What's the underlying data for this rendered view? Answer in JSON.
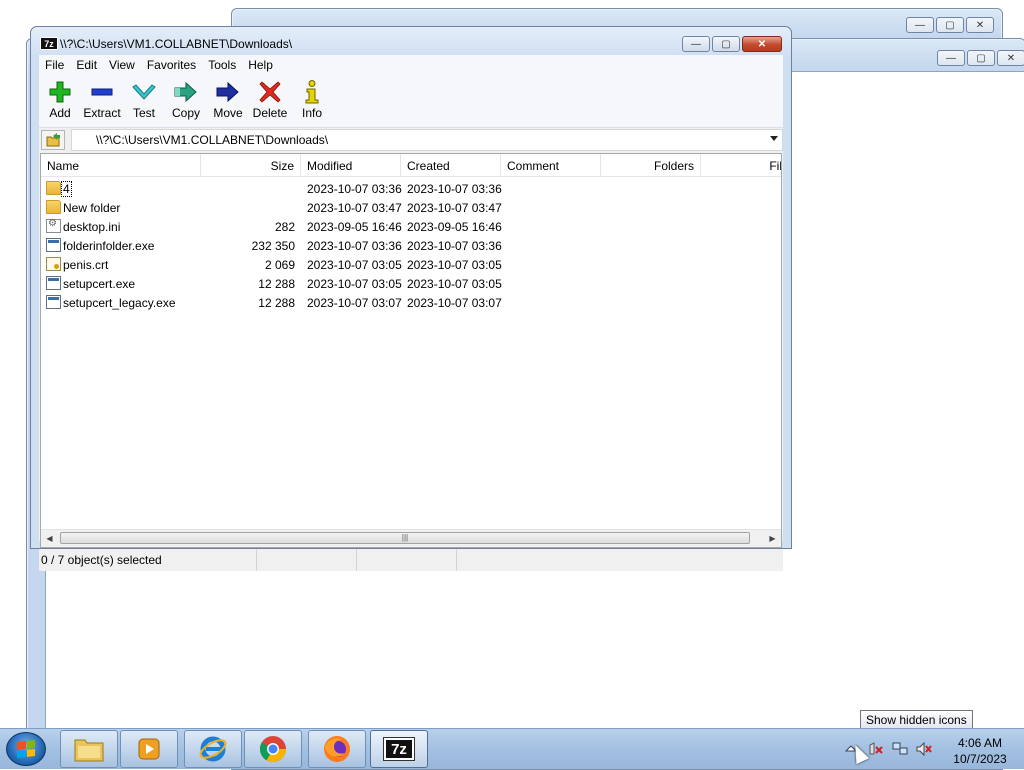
{
  "window": {
    "app_icon_label": "7z",
    "title": "\\\\?\\C:\\Users\\VM1.COLLABNET\\Downloads\\",
    "minimize": "—",
    "maximize": "▢",
    "close": "✕"
  },
  "menu": [
    "File",
    "Edit",
    "View",
    "Favorites",
    "Tools",
    "Help"
  ],
  "toolbar": [
    {
      "label": "Add",
      "icon": "plus-icon",
      "color": "#1aa01a"
    },
    {
      "label": "Extract",
      "icon": "minus-icon",
      "color": "#1f3fbf"
    },
    {
      "label": "Test",
      "icon": "check-arrow-icon",
      "color": "#26b7c4"
    },
    {
      "label": "Copy",
      "icon": "double-arrow-icon",
      "color": "#2a9c7a"
    },
    {
      "label": "Move",
      "icon": "arrow-right-icon",
      "color": "#1f2f9c"
    },
    {
      "label": "Delete",
      "icon": "x-icon",
      "color": "#d8241b"
    },
    {
      "label": "Info",
      "icon": "info-icon",
      "color": "#c9b800"
    }
  ],
  "address": {
    "path": "\\\\?\\C:\\Users\\VM1.COLLABNET\\Downloads\\"
  },
  "columns": [
    "Name",
    "Size",
    "Modified",
    "Created",
    "Comment",
    "Folders",
    "Fil"
  ],
  "files": [
    {
      "name": "4",
      "type": "folder",
      "size": "",
      "modified": "2023-10-07 03:36",
      "created": "2023-10-07 03:36"
    },
    {
      "name": "New folder",
      "type": "folder",
      "size": "",
      "modified": "2023-10-07 03:47",
      "created": "2023-10-07 03:47"
    },
    {
      "name": "desktop.ini",
      "type": "ini",
      "size": "282",
      "modified": "2023-09-05 16:46",
      "created": "2023-09-05 16:46"
    },
    {
      "name": "folderinfolder.exe",
      "type": "exe",
      "size": "232 350",
      "modified": "2023-10-07 03:36",
      "created": "2023-10-07 03:36"
    },
    {
      "name": "penis.crt",
      "type": "crt",
      "size": "2 069",
      "modified": "2023-10-07 03:05",
      "created": "2023-10-07 03:05"
    },
    {
      "name": "setupcert.exe",
      "type": "exe",
      "size": "12 288",
      "modified": "2023-10-07 03:05",
      "created": "2023-10-07 03:05"
    },
    {
      "name": "setupcert_legacy.exe",
      "type": "exe",
      "size": "12 288",
      "modified": "2023-10-07 03:07",
      "created": "2023-10-07 03:07"
    }
  ],
  "status": {
    "selection": "0 / 7 object(s) selected"
  },
  "taskbar": {
    "clock_time": "4:06 AM",
    "clock_date": "10/7/2023",
    "tooltip": "Show hidden icons"
  }
}
